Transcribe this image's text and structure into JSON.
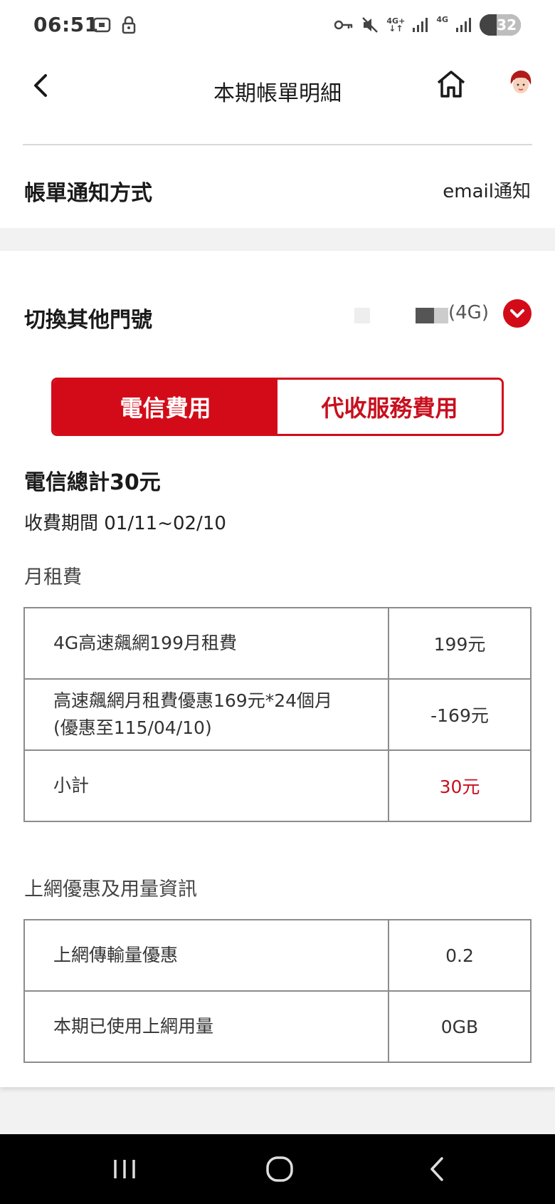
{
  "status_bar": {
    "time": "06:51",
    "network_1": "4G+",
    "network_2": "4G",
    "battery": "32"
  },
  "header": {
    "title": "本期帳單明細"
  },
  "notification": {
    "label": "帳單通知方式",
    "value": "email通知"
  },
  "number_switch": {
    "label": "切換其他門號",
    "suffix": "(4G)"
  },
  "tabs": [
    {
      "label": "電信費用",
      "active": true
    },
    {
      "label": "代收服務費用",
      "active": false
    }
  ],
  "summary": {
    "total": "電信總計30元",
    "period": "收費期間 01/11~02/10"
  },
  "monthly_fee": {
    "title": "月租費",
    "rows": [
      {
        "name": "4G高速飆網199月租費",
        "value": "199元"
      },
      {
        "name": "高速飆網月租費優惠169元*24個月",
        "name2": "(優惠至115/04/10)",
        "value": "-169元"
      },
      {
        "name": "小計",
        "value": "30元"
      }
    ]
  },
  "data_usage": {
    "title": "上網優惠及用量資訊",
    "rows": [
      {
        "name": "上網傳輸量優惠",
        "value": "0.2"
      },
      {
        "name": "本期已使用上網用量",
        "value": "0GB"
      }
    ]
  },
  "colors": {
    "accent": "#d30b19",
    "text": "#1a1a1a",
    "border": "#8c8c8c"
  }
}
